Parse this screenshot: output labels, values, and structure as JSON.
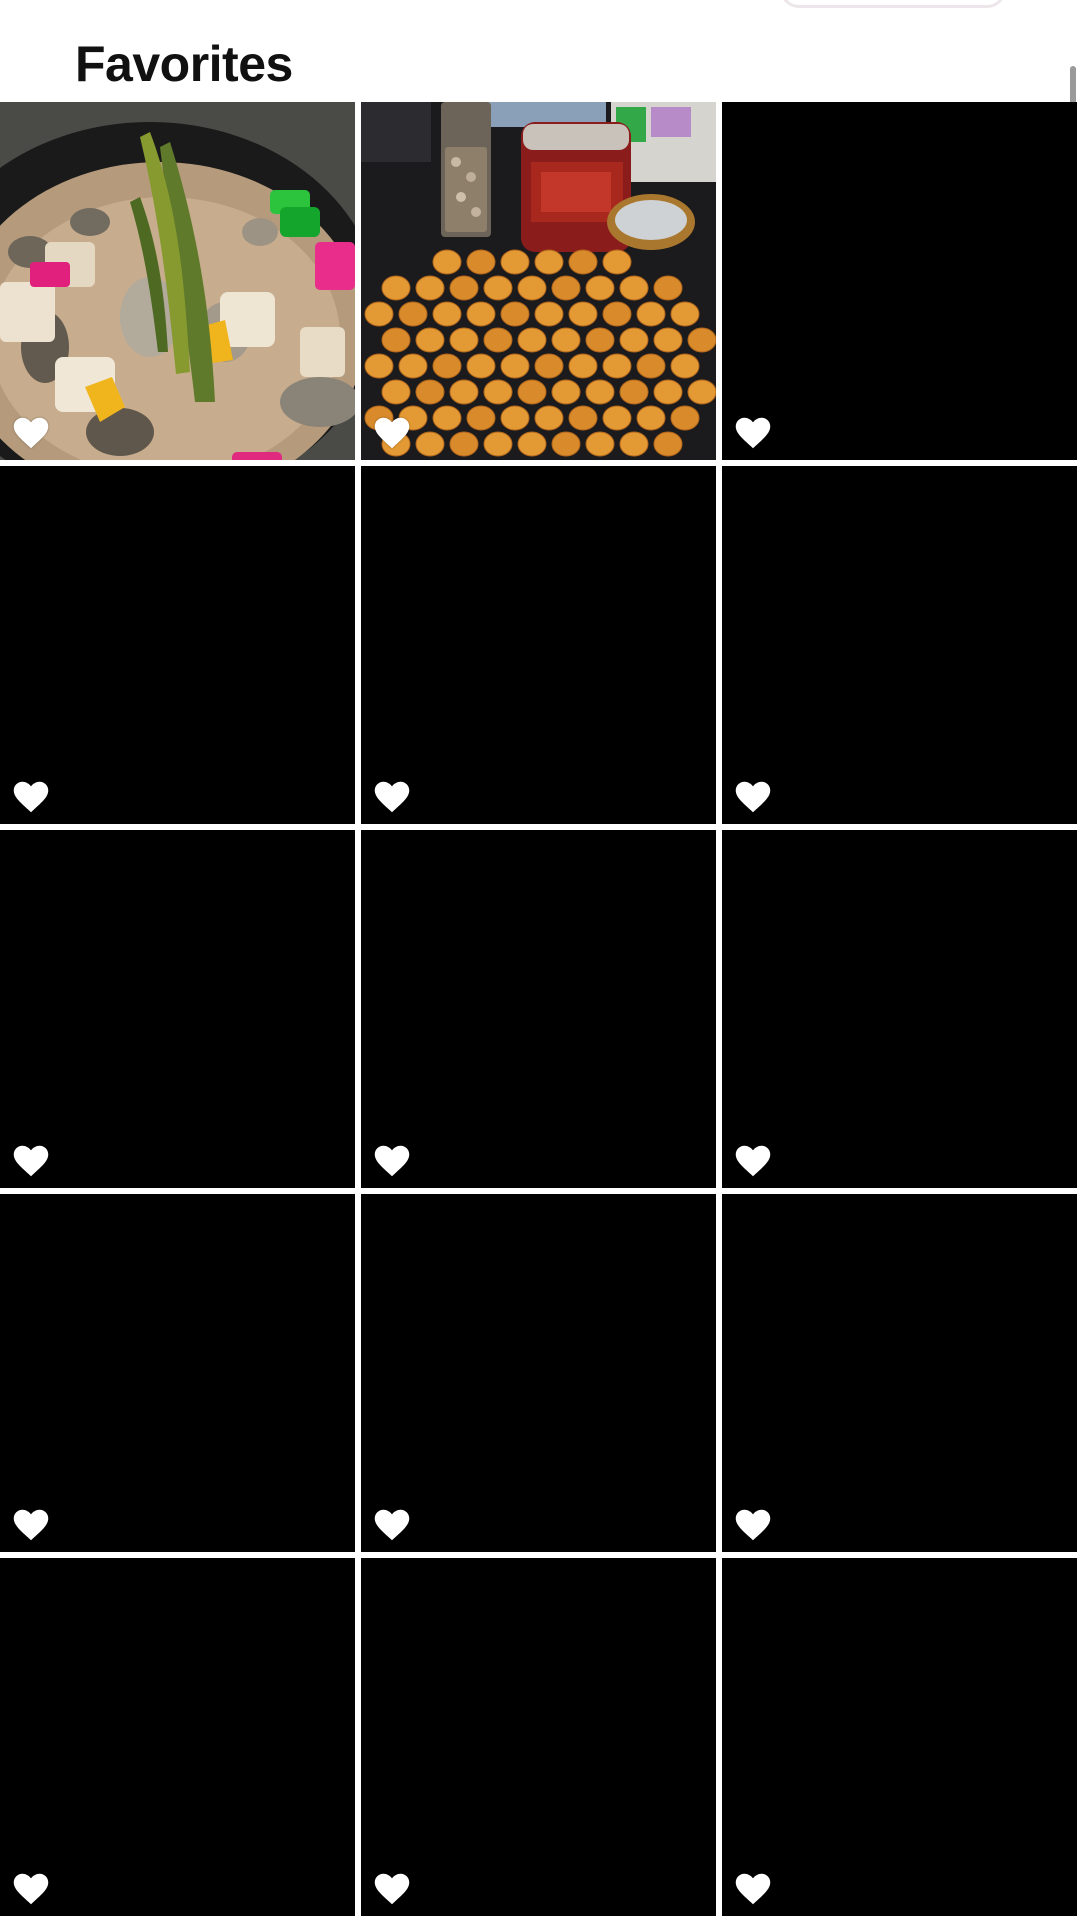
{
  "header": {
    "title": "Favorites"
  },
  "grid": {
    "columns": 3,
    "tiles": [
      {
        "thumbnail": "soup-dessert-photo",
        "favorited": true
      },
      {
        "thumbnail": "cookies-on-tray-photo",
        "favorited": true
      },
      {
        "thumbnail": "black-placeholder",
        "favorited": true
      },
      {
        "thumbnail": "black-placeholder",
        "favorited": true
      },
      {
        "thumbnail": "black-placeholder",
        "favorited": true
      },
      {
        "thumbnail": "black-placeholder",
        "favorited": true
      },
      {
        "thumbnail": "black-placeholder",
        "favorited": true
      },
      {
        "thumbnail": "black-placeholder",
        "favorited": true
      },
      {
        "thumbnail": "black-placeholder",
        "favorited": true
      },
      {
        "thumbnail": "black-placeholder",
        "favorited": true
      },
      {
        "thumbnail": "black-placeholder",
        "favorited": true
      },
      {
        "thumbnail": "black-placeholder",
        "favorited": true
      },
      {
        "thumbnail": "black-placeholder",
        "favorited": true
      },
      {
        "thumbnail": "black-placeholder",
        "favorited": true
      },
      {
        "thumbnail": "black-placeholder",
        "favorited": true
      }
    ]
  },
  "icons": {
    "favorite": "heart-icon"
  },
  "colors": {
    "background": "#ffffff",
    "tile_placeholder": "#000000",
    "heart": "#ffffff",
    "title": "#111111"
  }
}
